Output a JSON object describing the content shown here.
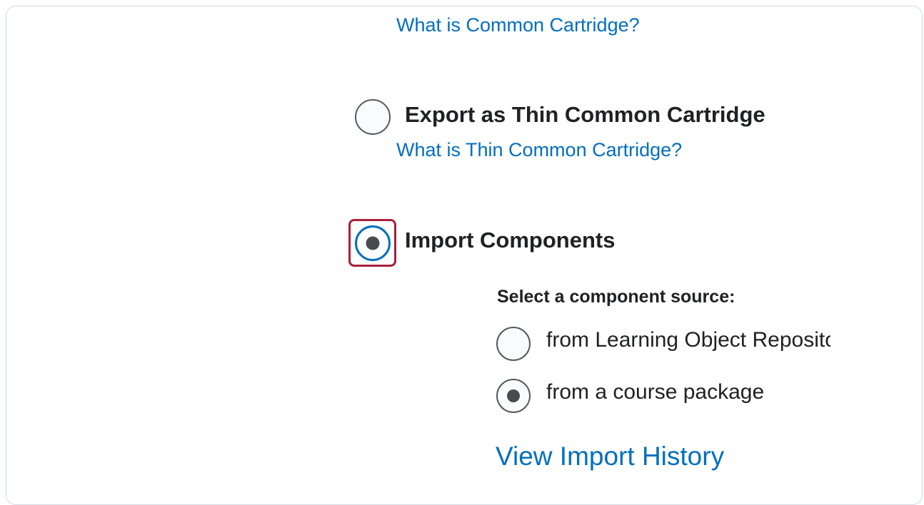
{
  "options": {
    "common_cartridge_help": "What is Common Cartridge?",
    "thin_cc": {
      "label": "Export as Thin Common Cartridge",
      "help": "What is Thin Common Cartridge?",
      "selected": false
    },
    "import_components": {
      "label": "Import Components",
      "selected": true,
      "source_heading": "Select a component source:",
      "sources": [
        {
          "label": "from Learning Object Repository",
          "selected": false
        },
        {
          "label": "from a course package",
          "selected": true
        }
      ],
      "history_link": "View Import History"
    }
  },
  "colors": {
    "link": "#006fbf",
    "focus_ring": "#a8203c",
    "text": "#202122"
  }
}
